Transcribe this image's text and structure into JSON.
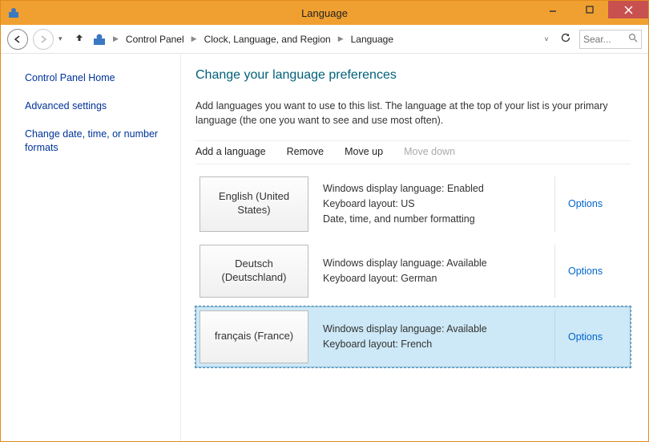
{
  "window": {
    "title": "Language"
  },
  "breadcrumb": {
    "items": [
      "Control Panel",
      "Clock, Language, and Region",
      "Language"
    ]
  },
  "search": {
    "placeholder": "Sear..."
  },
  "sidebar": {
    "items": [
      {
        "label": "Control Panel Home"
      },
      {
        "label": "Advanced settings"
      },
      {
        "label": "Change date, time, or number formats"
      }
    ]
  },
  "content": {
    "heading": "Change your language preferences",
    "description": "Add languages you want to use to this list. The language at the top of your list is your primary language (the one you want to see and use most often)."
  },
  "toolbar": {
    "add": "Add a language",
    "remove": "Remove",
    "moveup": "Move up",
    "movedown": "Move down",
    "movedown_disabled": true
  },
  "languages": [
    {
      "name": "English (United States)",
      "details": [
        "Windows display language: Enabled",
        "Keyboard layout: US",
        "Date, time, and number formatting"
      ],
      "options": "Options",
      "selected": false
    },
    {
      "name": "Deutsch (Deutschland)",
      "details": [
        "Windows display language: Available",
        "Keyboard layout: German"
      ],
      "options": "Options",
      "selected": false
    },
    {
      "name": "français (France)",
      "details": [
        "Windows display language: Available",
        "Keyboard layout: French"
      ],
      "options": "Options",
      "selected": true
    }
  ]
}
